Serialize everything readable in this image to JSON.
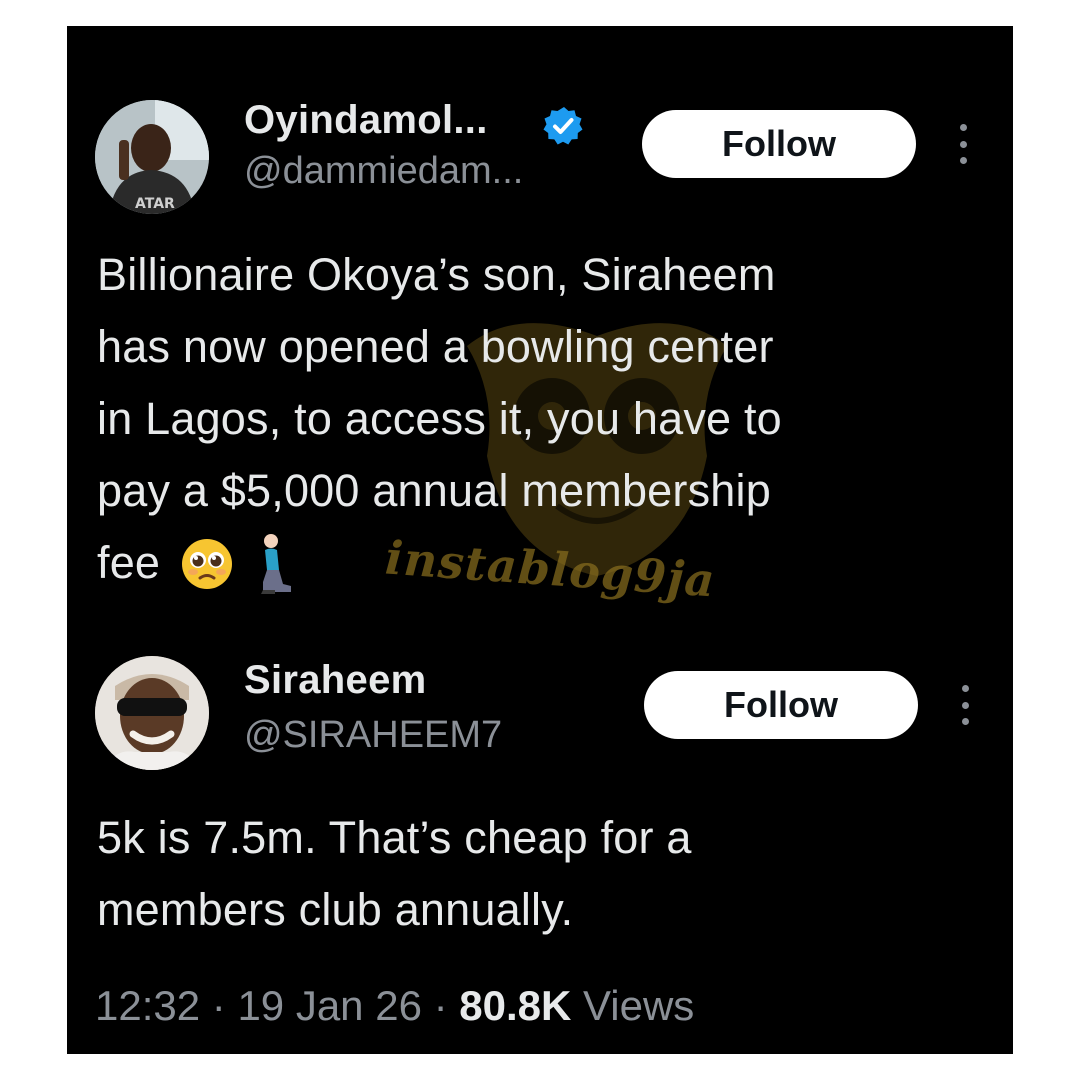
{
  "post": {
    "author_name": "Oyindamol...",
    "author_handle": "@dammiedam...",
    "follow_label": "Follow",
    "text": "Billionaire Okoya’s son, Siraheem\nhas now opened a bowling center\nin Lagos,  to access it, you have to\npay a $5,000 annual membership\nfee"
  },
  "reply": {
    "author_name": "Siraheem",
    "author_handle": "@SIRAHEEM7",
    "follow_label": "Follow",
    "text": "5k is 7.5m. That’s cheap for a\nmembers club annually.",
    "time": "12:32",
    "date": "19 Jan 26",
    "views_count": "80.8K",
    "views_label": "Views"
  },
  "watermark": {
    "text": "instablog9ja"
  },
  "icons": {
    "verified": "verified-badge-icon",
    "more": "more-options-icon",
    "emoji_1": "pleading-face-emoji",
    "emoji_2": "kneeling-person-emoji"
  },
  "colors": {
    "background": "#000000",
    "text_primary": "#e7e9ea",
    "text_secondary": "#8b9097",
    "verified_blue": "#1d9bf0",
    "follow_bg": "#ffffff",
    "watermark": "#8a6f1f"
  }
}
